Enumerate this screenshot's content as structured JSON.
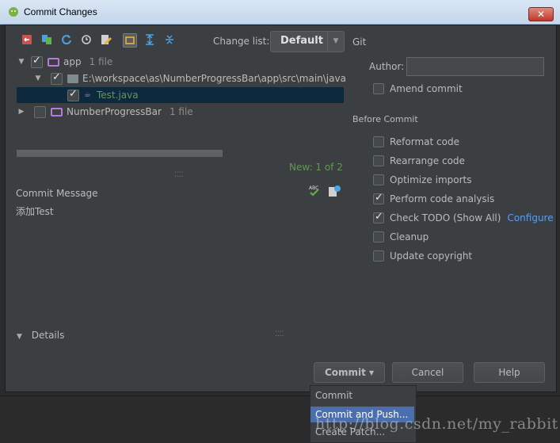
{
  "window": {
    "title": "Commit Changes",
    "close_label": "✕"
  },
  "toolbar": {
    "icons": [
      "revert-icon",
      "diff-icon",
      "refresh-icon",
      "history-icon",
      "edit-source-icon",
      "group-by-module-icon",
      "expand-all-icon",
      "collapse-all-icon"
    ],
    "change_list_label": "Change list:",
    "change_list_value": "Default"
  },
  "tree": {
    "module_app": {
      "name": "app",
      "count": "1 file"
    },
    "path": "E:\\workspace\\as\\NumberProgressBar\\app\\src\\main\\java",
    "file": "Test.java",
    "module_lib": {
      "name": "NumberProgressBar",
      "count": "1 file"
    }
  },
  "new_count": "New: 1 of 2",
  "commit_message": {
    "label": "Commit Message",
    "text": "添加Test"
  },
  "details_label": "Details",
  "git": {
    "section_label": "Git",
    "author_label": "Author:",
    "author_value": "",
    "amend_label": "Amend commit"
  },
  "before_commit": {
    "label": "Before Commit",
    "options": [
      {
        "label": "Reformat code",
        "checked": false
      },
      {
        "label": "Rearrange code",
        "checked": false
      },
      {
        "label": "Optimize imports",
        "checked": false
      },
      {
        "label": "Perform code analysis",
        "checked": true
      },
      {
        "label": "Check TODO (Show All)",
        "checked": true,
        "link": "Configure"
      },
      {
        "label": "Cleanup",
        "checked": false
      },
      {
        "label": "Update copyright",
        "checked": false
      }
    ]
  },
  "buttons": {
    "commit": "Commit ▾",
    "cancel": "Cancel",
    "help": "Help"
  },
  "commit_menu": [
    "Commit",
    "Commit and Push...",
    "Create Patch..."
  ],
  "watermark": "http://blog.csdn.net/my_rabbit"
}
